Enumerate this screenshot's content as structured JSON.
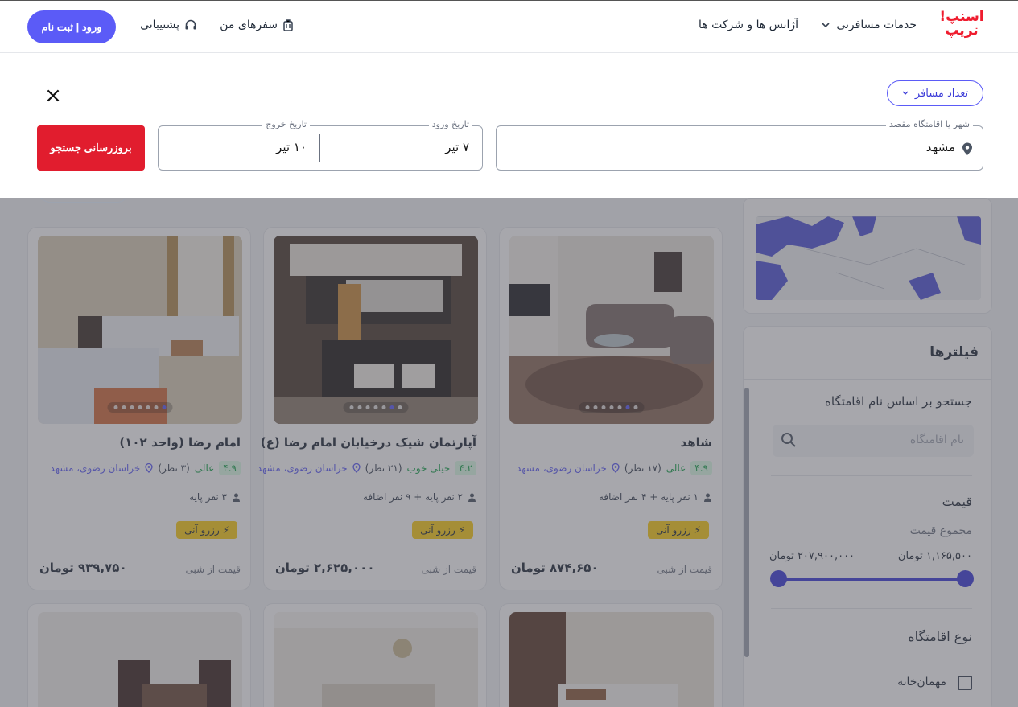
{
  "header": {
    "logo_text": "اسنپ! تریپ",
    "nav": {
      "travel_services": "خدمات مسافرتی",
      "agencies": "آژانس ها و شرکت ها",
      "my_trips": "سفرهای من",
      "support": "پشتیبانی"
    },
    "login_label": "ورود | ثبت نام"
  },
  "search": {
    "passengers_label": "تعداد مسافر",
    "destination_legend": "شهر یا اقامتگاه مقصد",
    "destination_value": "مشهد",
    "checkin_legend": "تاریخ ورود",
    "checkin_value": "۷ تیر",
    "checkout_legend": "تاریخ خروج",
    "checkout_value": "۱۰ تیر",
    "update_label": "بروزرسانی جستجو"
  },
  "listings": [
    {
      "title": "شاهد",
      "score": "۴.۹",
      "score_word": "عالی",
      "reviews": "(۱۷ نظر)",
      "location": "خراسان رضوی، مشهد",
      "capacity": "۱ نفر پایه + ۴ نفر اضافه",
      "instant": "رزرو آنی",
      "price_label": "قیمت از شبی",
      "price": "۸۷۴,۶۵۰ تومان"
    },
    {
      "title": "آپارتمان شیک درخیابان امام رضا (ع)",
      "score": "۴.۲",
      "score_word": "خیلی خوب",
      "reviews": "(۲۱ نظر)",
      "location": "خراسان رضوی، مشهد",
      "capacity": "۲ نفر پایه + ۹ نفر اضافه",
      "instant": "رزرو آنی",
      "price_label": "قیمت از شبی",
      "price": "۲,۶۲۵,۰۰۰ تومان"
    },
    {
      "title": "امام رضا (واحد ۱۰۲)",
      "score": "۴.۹",
      "score_word": "عالی",
      "reviews": "(۳ نظر)",
      "location": "خراسان رضوی، مشهد",
      "capacity": "۳ نفر پایه",
      "instant": "رزرو آنی",
      "price_label": "قیمت از شبی",
      "price": "۹۳۹,۷۵۰ تومان"
    }
  ],
  "filters": {
    "title": "فیلترها",
    "name_search_label": "جستجو بر اساس نام اقامتگاه",
    "name_search_placeholder": "نام اقامتگاه",
    "price_title": "قیمت",
    "price_subtitle": "مجموع قیمت",
    "price_min": "۱,۱۶۵,۵۰۰ تومان",
    "price_max": "۲۰۷,۹۰۰,۰۰۰ تومان",
    "type_title": "نوع اقامتگاه",
    "type_option_1": "مهمان‌خانه"
  },
  "colors": {
    "brand_red": "#e11d2e",
    "accent_blue": "#5b5bf7"
  }
}
